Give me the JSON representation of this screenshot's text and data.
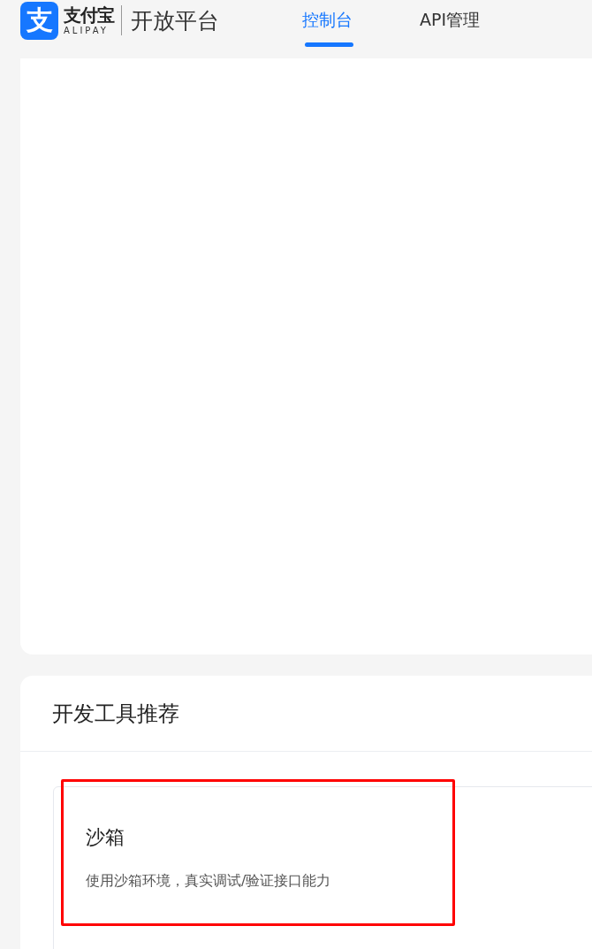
{
  "header": {
    "logo": {
      "icon_glyph": "支",
      "name": "支付宝",
      "latin": "ALIPAY"
    },
    "platform": "开放平台",
    "tabs": [
      {
        "label": "控制台",
        "selected": true
      },
      {
        "label": "API管理",
        "selected": false
      }
    ]
  },
  "tools_section": {
    "title": "开发工具推荐",
    "tools": [
      {
        "name": "沙箱",
        "description": "使用沙箱环境，真实调试/验证接口能力",
        "highlighted": true
      }
    ]
  }
}
